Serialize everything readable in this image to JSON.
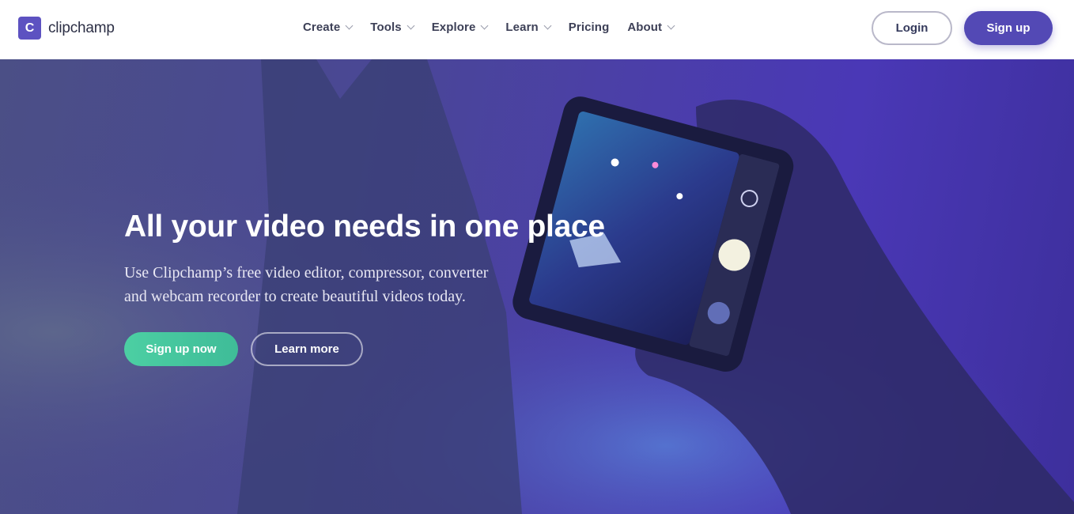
{
  "header": {
    "logo_text": "clipchamp",
    "logo_mark": "C",
    "nav": [
      {
        "label": "Create",
        "has_dropdown": true
      },
      {
        "label": "Tools",
        "has_dropdown": true
      },
      {
        "label": "Explore",
        "has_dropdown": true
      },
      {
        "label": "Learn",
        "has_dropdown": true
      },
      {
        "label": "Pricing",
        "has_dropdown": false
      },
      {
        "label": "About",
        "has_dropdown": true
      }
    ],
    "login_label": "Login",
    "signup_label": "Sign up"
  },
  "hero": {
    "title": "All your video needs in one place",
    "subtitle_line1": "Use Clipchamp’s free video editor, compressor, converter",
    "subtitle_line2": "and webcam recorder to create beautiful videos today.",
    "cta_primary": "Sign up now",
    "cta_secondary": "Learn more"
  },
  "colors": {
    "brand": "#5d52c1",
    "signup_button": "#5349b5",
    "cta_green": "#4ccfa3",
    "hero_overlay": "#4a3fb0"
  }
}
